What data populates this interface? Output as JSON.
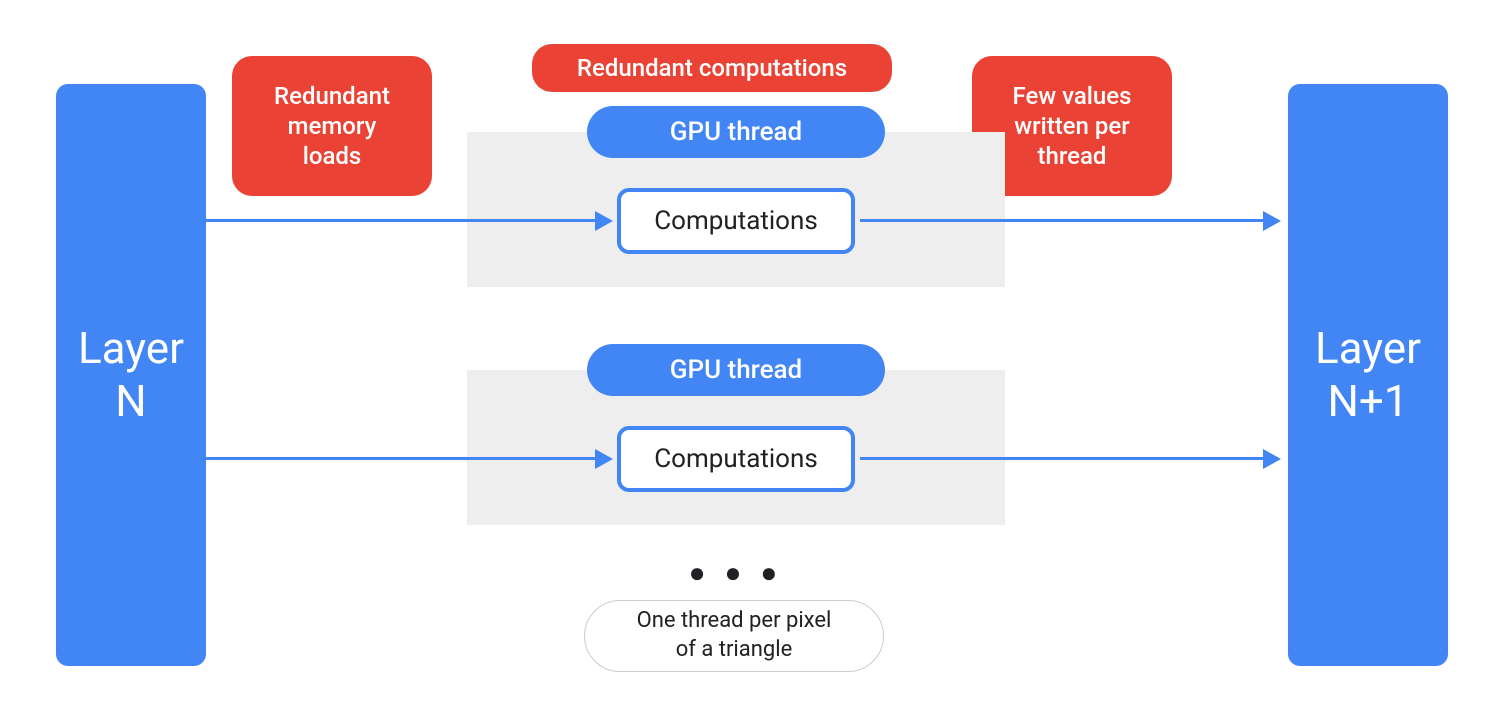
{
  "layers": {
    "left": "Layer\nN",
    "right": "Layer\nN+1"
  },
  "annotations": {
    "redundant_memory": "Redundant\nmemory\nloads",
    "redundant_computations": "Redundant computations",
    "few_values": "Few values\nwritten per\nthread",
    "footer_pill": "One thread per pixel\nof a triangle"
  },
  "thread": {
    "label": "GPU thread",
    "computation": "Computations"
  },
  "dots": "● ● ●",
  "colors": {
    "blue": "#4285F4",
    "red": "#EA4335",
    "gray": "#EEEEEE"
  }
}
